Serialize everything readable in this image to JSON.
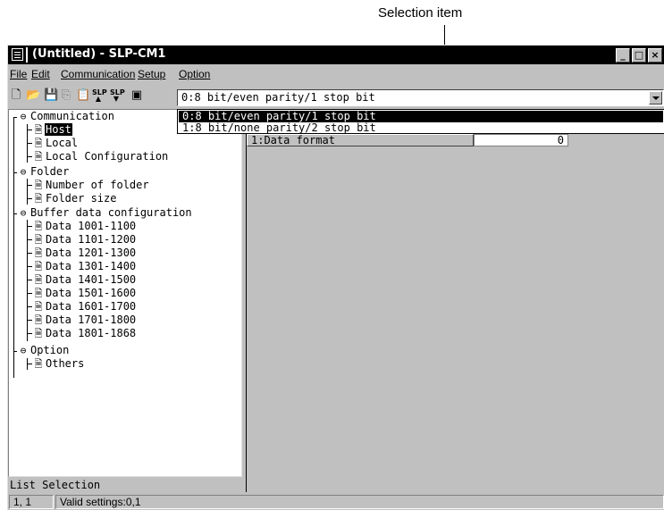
{
  "callout": {
    "label": "Selection item"
  },
  "window": {
    "title": "(Untitled) - SLP-CM1",
    "controls": {
      "minimize": "_",
      "maximize": "□",
      "close": "×"
    }
  },
  "menu": [
    {
      "label": "File"
    },
    {
      "label": "Edit"
    },
    {
      "label": "Communication"
    },
    {
      "label": "Setup"
    },
    {
      "label": "Option"
    }
  ],
  "toolbar": {
    "icons": [
      "new-file-icon",
      "open-folder-icon",
      "save-icon",
      "copy-icon",
      "paste-icon",
      "upload-slp-icon",
      "download-slp-icon",
      "print-preview-icon"
    ],
    "slp_up_label": "SLP",
    "slp_down_label": "SLP"
  },
  "combo": {
    "selected": "0:8 bit/even parity/1 stop bit",
    "options": [
      {
        "label": "0:8 bit/even parity/1 stop bit",
        "selected": true
      },
      {
        "label": "1:8 bit/none parity/2 stop bit",
        "selected": false
      }
    ]
  },
  "tree": {
    "communication": "Communication",
    "host": "Host",
    "local": "Local",
    "local_config": "Local Configuration",
    "folder": "Folder",
    "number_of_folder": "Number of folder",
    "folder_size": "Folder size",
    "buffer": "Buffer data configuration",
    "data_ranges": [
      "Data 1001-1100",
      "Data 1101-1200",
      "Data 1201-1300",
      "Data 1301-1400",
      "Data 1401-1500",
      "Data 1501-1600",
      "Data 1601-1700",
      "Data 1701-1800",
      "Data 1801-1868"
    ],
    "option": "Option",
    "others": "Others"
  },
  "list_selection": "List Selection",
  "grid": {
    "row_label": "1:Data format",
    "row_value": "0"
  },
  "status": {
    "position": "1, 1",
    "message": "Valid settings:0,1"
  },
  "colors": {
    "title_bar": "#000000",
    "face": "#c0c0c0",
    "selection": "#000000"
  }
}
